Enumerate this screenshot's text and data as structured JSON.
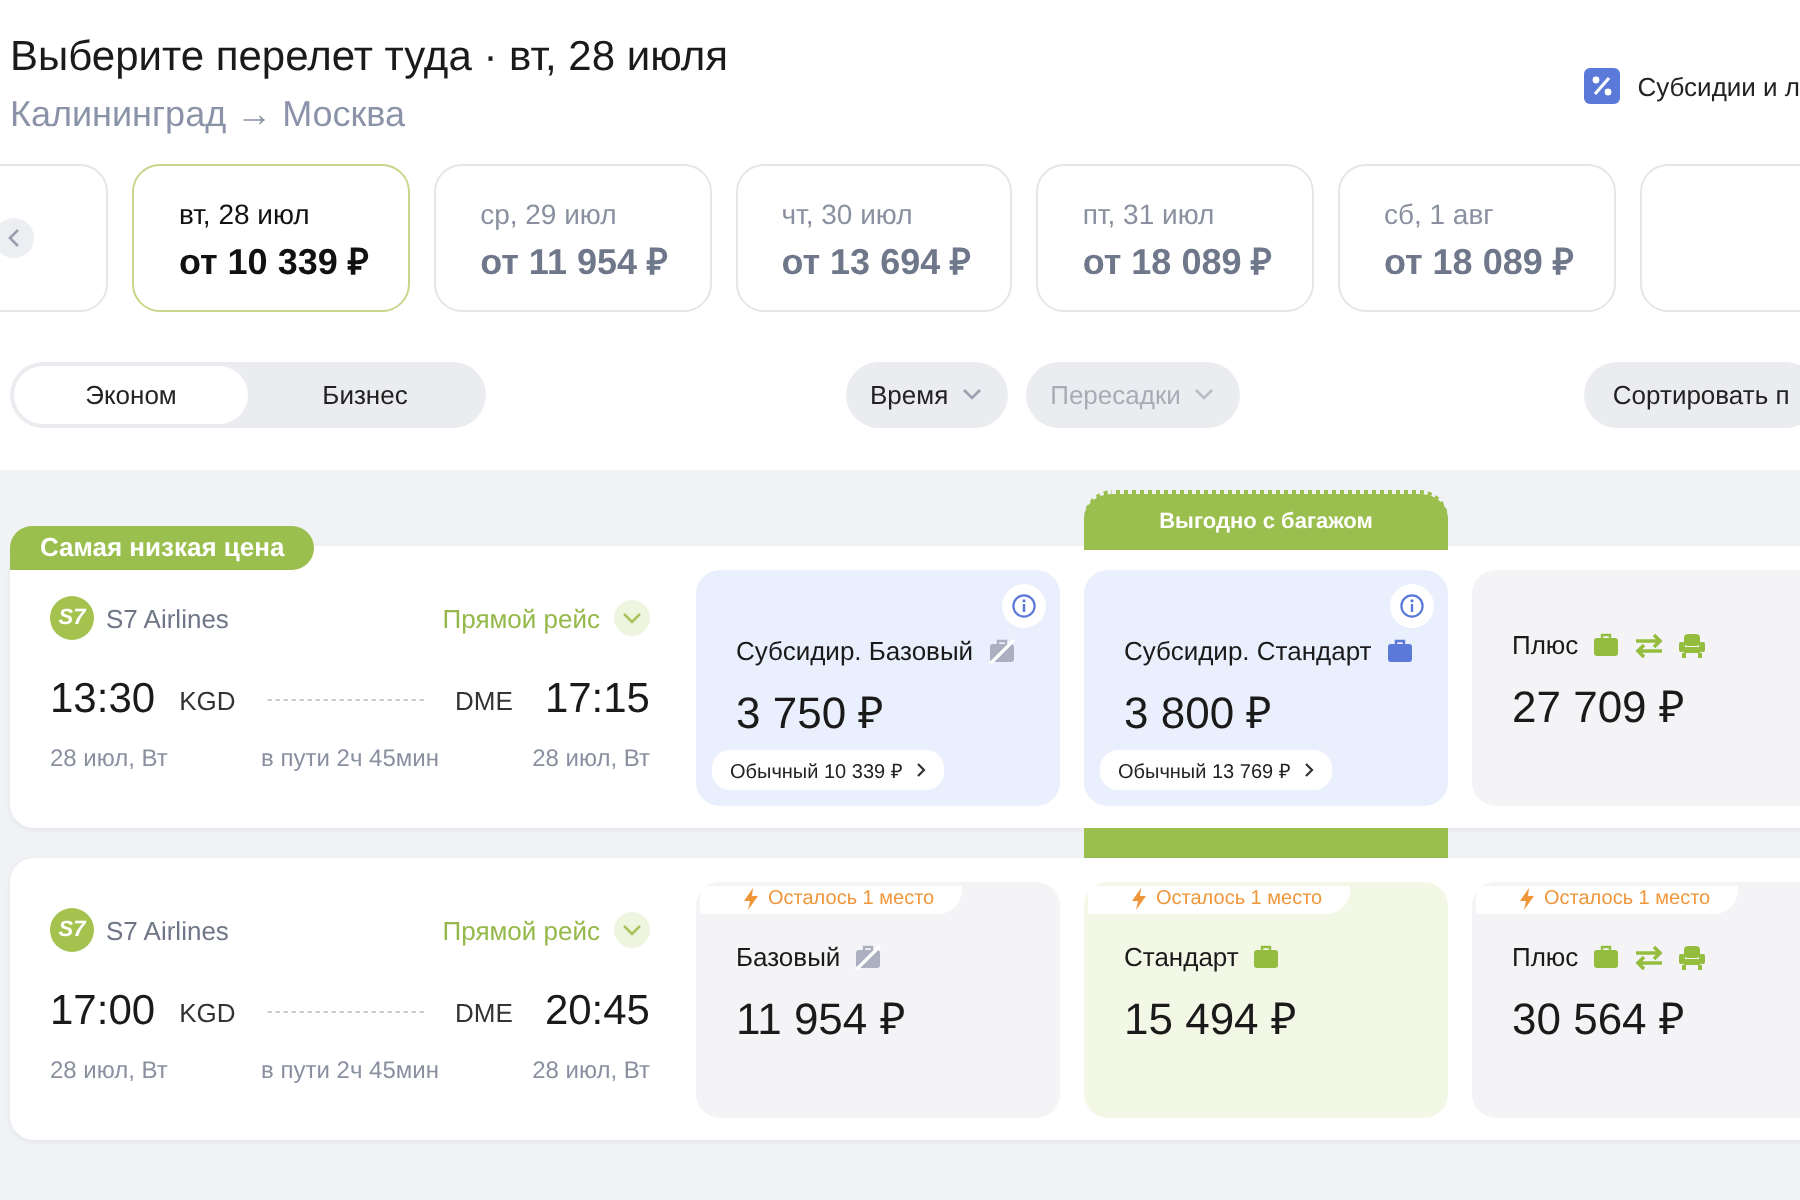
{
  "header": {
    "title": "Выберите перелет туда · вт, 28 июля",
    "route": "Калининград → Москва",
    "subsidy_link": "Субсидии и л"
  },
  "dates": [
    {
      "day": "вт, 28 июл",
      "price": "от 10 339 ₽",
      "selected": true
    },
    {
      "day": "ср, 29 июл",
      "price": "от 11 954 ₽",
      "selected": false
    },
    {
      "day": "чт, 30 июл",
      "price": "от 13 694 ₽",
      "selected": false
    },
    {
      "day": "пт, 31 июл",
      "price": "от 18 089 ₽",
      "selected": false
    },
    {
      "day": "сб, 1 авг",
      "price": "от 18 089 ₽",
      "selected": false
    }
  ],
  "cabin_classes": [
    {
      "label": "Эконом",
      "selected": true
    },
    {
      "label": "Бизнес",
      "selected": false
    }
  ],
  "filters": [
    {
      "label": "Время",
      "disabled": false
    },
    {
      "label": "Пересадки",
      "disabled": true
    }
  ],
  "sort_button": "Сортировать п",
  "highlight_label": "Выгодно с багажом",
  "flights": [
    {
      "badge": "Самая низкая цена",
      "logo": "S7",
      "airline": "S7 Airlines",
      "direct": "Прямой рейс",
      "dep_time": "13:30",
      "dep_code": "KGD",
      "arr_code": "DME",
      "arr_time": "17:15",
      "dep_date": "28 июл, Вт",
      "duration": "в пути 2ч 45мин",
      "arr_date": "28 июл, Вт",
      "fares": [
        {
          "kind": "subsidized",
          "highlighted": false,
          "info": true,
          "name": "Субсидир. Базовый",
          "icons": [
            {
              "kind": "no-baggage"
            }
          ],
          "price": "3 750 ₽",
          "regular": "Обычный 10 339 ₽"
        },
        {
          "kind": "subsidized",
          "highlighted": true,
          "info": true,
          "name": "Субсидир. Стандарт",
          "icons": [
            {
              "kind": "baggage"
            }
          ],
          "price": "3 800 ₽",
          "regular": "Обычный 13 769 ₽"
        },
        {
          "kind": "plain",
          "highlighted": false,
          "info": false,
          "name": "Плюс",
          "icons": [
            {
              "kind": "baggage"
            },
            {
              "kind": "exchange"
            },
            {
              "kind": "seat"
            }
          ],
          "price": "27 709 ₽"
        }
      ]
    },
    {
      "logo": "S7",
      "airline": "S7 Airlines",
      "direct": "Прямой рейс",
      "dep_time": "17:00",
      "dep_code": "KGD",
      "arr_code": "DME",
      "arr_time": "20:45",
      "dep_date": "28 июл, Вт",
      "duration": "в пути 2ч 45мин",
      "arr_date": "28 июл, Вт",
      "fares": [
        {
          "kind": "plain",
          "highlighted": false,
          "info": false,
          "seats_left": "Осталось 1 место",
          "name": "Базовый",
          "icons": [
            {
              "kind": "no-baggage"
            }
          ],
          "price": "11 954 ₽"
        },
        {
          "kind": "featured",
          "highlighted": false,
          "info": false,
          "seats_left": "Осталось 1 место",
          "name": "Стандарт",
          "icons": [
            {
              "kind": "baggage"
            }
          ],
          "price": "15 494 ₽"
        },
        {
          "kind": "plain",
          "highlighted": false,
          "info": false,
          "seats_left": "Осталось 1 место",
          "name": "Плюс",
          "icons": [
            {
              "kind": "baggage"
            },
            {
              "kind": "exchange"
            },
            {
              "kind": "seat"
            }
          ],
          "price": "30 564 ₽"
        }
      ]
    }
  ]
}
